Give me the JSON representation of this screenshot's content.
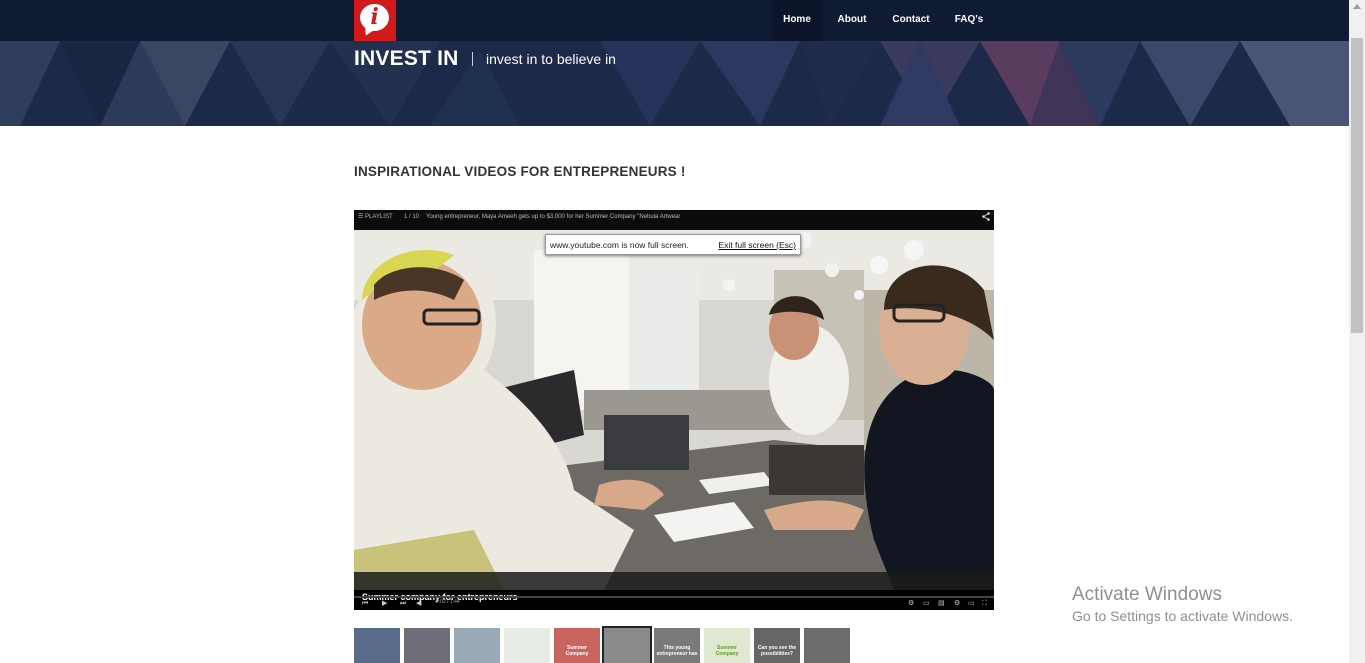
{
  "header": {
    "logo_letter": "i",
    "nav": [
      {
        "label": "Home",
        "active": true
      },
      {
        "label": "About",
        "active": false
      },
      {
        "label": "Contact",
        "active": false
      },
      {
        "label": "FAQ's",
        "active": false
      }
    ]
  },
  "hero": {
    "brand": "INVEST IN",
    "tagline": "invest in to believe in"
  },
  "main": {
    "title": "INSPIRATIONAL VIDEOS FOR ENTREPRENEURS !"
  },
  "player": {
    "playlist_label": "☰ PLAYLIST",
    "playlist_count": "1 / 10",
    "video_title": "Young entrepreneur, Maya Ameeh gets up to $3,000 for her Summer Company \"Nebula Artwear",
    "fullscreen_message": "www.youtube.com is now full screen.",
    "exit_fullscreen": "Exit full screen (Esc)",
    "caption": "Summer company for entrepreneurs",
    "time": "0:02 / 1:44",
    "progress": 0.0
  },
  "thumbnails": [
    {
      "label": "",
      "color": "#5a6a8a"
    },
    {
      "label": "",
      "color": "#6e6e78"
    },
    {
      "label": "",
      "color": "#9aa9b8"
    },
    {
      "label": "",
      "color": "#e7ece6"
    },
    {
      "label": "Summer Company",
      "color": "#c9645f"
    },
    {
      "label": "",
      "color": "#8a8a8a"
    },
    {
      "label": "This young entrepreneur has",
      "color": "#7a7a7a"
    },
    {
      "label": "Summer Company",
      "color": "#dfe8d0"
    },
    {
      "label": "Can you see the possibilities?",
      "color": "#666666"
    },
    {
      "label": "",
      "color": "#6c6c6c"
    }
  ],
  "os_watermark": {
    "line1": "Activate Windows",
    "line2": "Go to Settings to activate Windows."
  },
  "colors": {
    "nav_bg": "#0f1a33",
    "logo_red": "#d11a1a",
    "hero_bg": "#1e2a4a",
    "title_text": "#333333"
  }
}
